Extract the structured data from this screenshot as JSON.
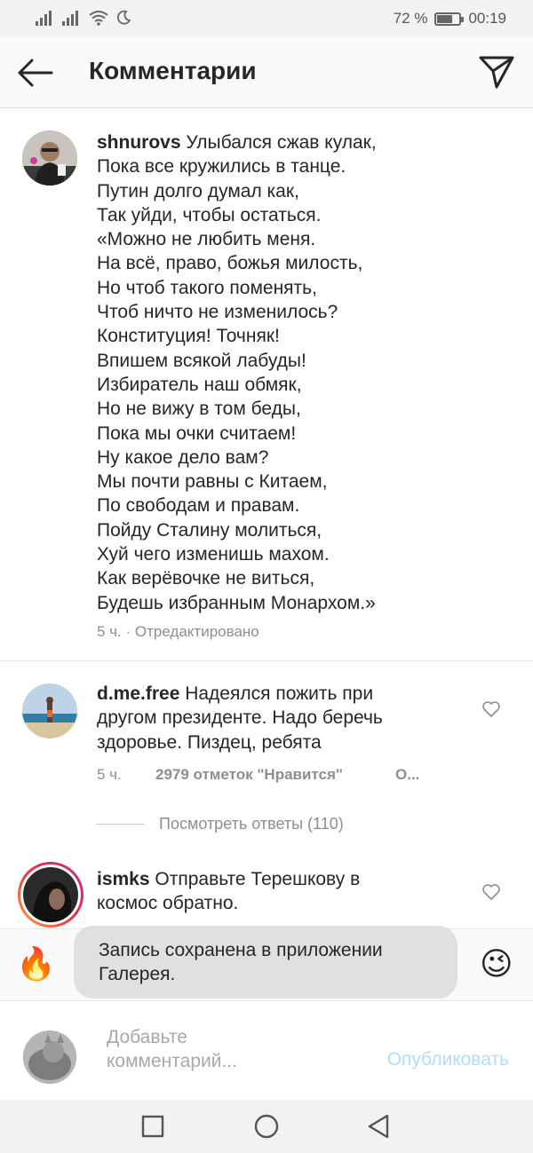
{
  "status_bar": {
    "battery": "72 %",
    "battery_level": 0.72,
    "time": "00:19"
  },
  "header": {
    "title": "Комментарии"
  },
  "comments": [
    {
      "username": "shnurovs",
      "text": " Улыбался сжав кулак,\nПока все кружились в танце.\nПутин долго думал как,\nТак уйди, чтобы остаться.\n«Можно не любить меня.\nНа всё, право, божья милость,\nНо чтоб такого поменять,\nЧтоб ничто не изменилось?\nКонституция! Точняк!\nВпишем всякой лабуды!\nИзбиратель наш обмяк,\nНо не вижу в том беды,\nПока мы очки считаем!\nНу какое дело вам?\nМы почти равны с Китаем,\nПо свободам и правам.\nПойду Сталину молиться,\nХуй чего изменишь махом.\nКак верёвочке не виться,\nБудешь избранным Монархом.»",
      "time": "5 ч.",
      "edited": " · Отредактировано"
    },
    {
      "username": "d.me.free",
      "text": " Надеялся пожить при\nдругом президенте. Надо беречь\nздоровье. Пиздец, ребята",
      "time": "5 ч.",
      "likes": "2979 отметок \"Нравится\"",
      "reply": "О..."
    },
    {
      "username": "ismks",
      "text": " Отправьте Терешкову в\nкосмос обратно."
    }
  ],
  "view_replies": "Посмотреть ответы (110)",
  "emoji_bar": [
    "🔥",
    "😉"
  ],
  "toast": "Запись сохранена в приложении\nГалерея.",
  "input": {
    "placeholder": "Добавьте\nкомментарий...",
    "publish_label": "Опубликовать"
  }
}
